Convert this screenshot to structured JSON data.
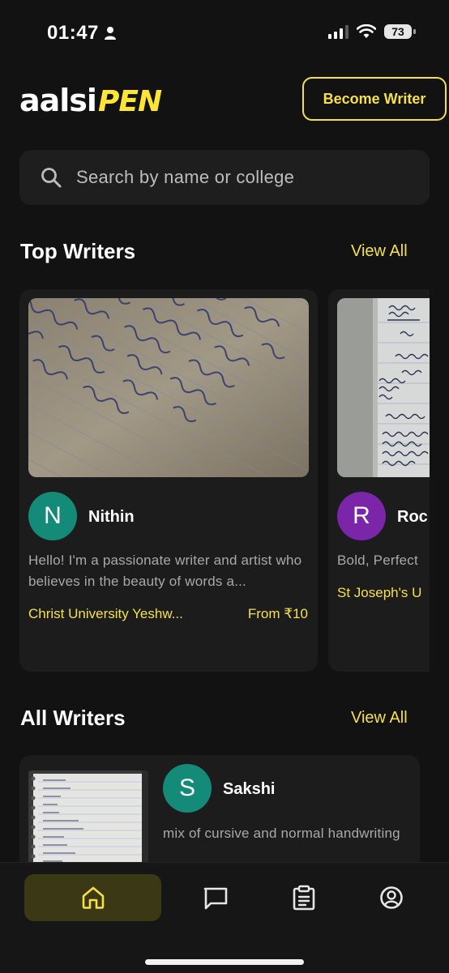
{
  "status_bar": {
    "time": "01:47",
    "battery": "73"
  },
  "header": {
    "logo_main": "aalsi",
    "logo_accent": "PEN",
    "become_writer": "Become Writer"
  },
  "search": {
    "placeholder": "Search by name or college"
  },
  "top_writers": {
    "title": "Top Writers",
    "view_all": "View All",
    "cards": [
      {
        "initial": "N",
        "name": "Nithin",
        "description": "Hello! I'm a passionate writer and artist who believes in the beauty of words a...",
        "college": "Christ University Yeshw...",
        "price": "From ₹10",
        "avatar_color": "#148a78"
      },
      {
        "initial": "R",
        "name": "Roc",
        "description": "Bold, Perfect",
        "college": "St Joseph's U",
        "avatar_color": "#7b25a8"
      }
    ]
  },
  "all_writers": {
    "title": "All Writers",
    "view_all": "View All",
    "items": [
      {
        "initial": "S",
        "name": "Sakshi",
        "description": "mix of cursive and normal handwriting",
        "avatar_color": "#148a78"
      }
    ]
  },
  "bottom_nav": {
    "items": [
      "home-icon",
      "chat-icon",
      "clipboard-icon",
      "profile-icon"
    ],
    "active": "home-icon"
  },
  "colors": {
    "accent": "#f5e04a",
    "background": "#121212",
    "card": "#1c1c1c"
  }
}
